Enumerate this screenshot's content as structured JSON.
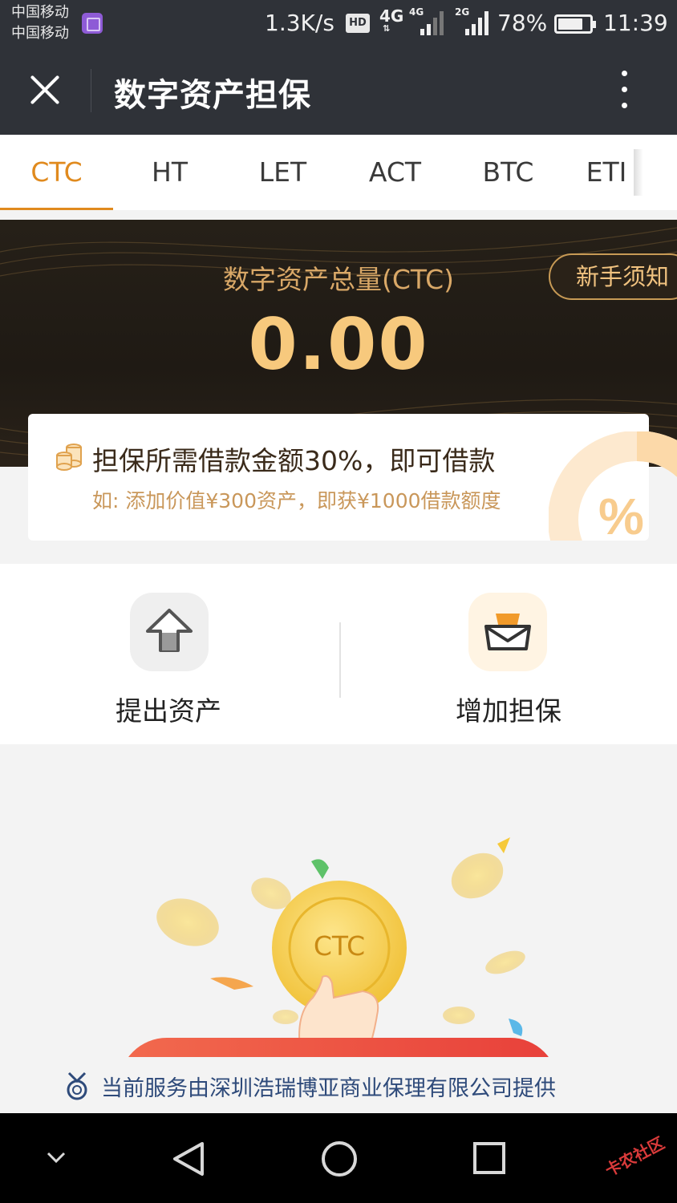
{
  "status_bar": {
    "carrier_1": "中国移动",
    "carrier_2": "中国移动",
    "net_speed": "1.3K/s",
    "hd_badge": "HD",
    "network_type": "4G",
    "sim1_tag": "4G",
    "sim2_tag": "2G",
    "battery": "78%",
    "time": "11:39"
  },
  "header": {
    "title": "数字资产担保",
    "close_icon": "close-icon",
    "more_icon": "more-vertical-icon"
  },
  "tabs": [
    {
      "label": "CTC",
      "active": true
    },
    {
      "label": "HT",
      "active": false
    },
    {
      "label": "LET",
      "active": false
    },
    {
      "label": "ACT",
      "active": false
    },
    {
      "label": "BTC",
      "active": false
    },
    {
      "label": "ETI",
      "active": false
    }
  ],
  "banner": {
    "total_label": "数字资产总量(CTC)",
    "total_value": "0.00",
    "guide_button": "新手须知"
  },
  "info_card": {
    "title": "担保所需借款金额30%，即可借款",
    "subtitle": "如: 添加价值¥300资产，即获¥1000借款额度",
    "icon": "coins-icon"
  },
  "actions": {
    "withdraw": {
      "label": "提出资产",
      "icon": "upload-arrow-icon"
    },
    "add": {
      "label": "增加担保",
      "icon": "wallet-icon"
    }
  },
  "illustration": {
    "coin_label": "CTC"
  },
  "provider_note": "当前服务由深圳浩瑞博亚商业保理有限公司提供",
  "watermark": "卡农社区",
  "colors": {
    "accent": "#e08a1e",
    "header_bg": "#2f3238",
    "banner_gold": "#f7c97d",
    "provider_text": "#2e4a7a"
  }
}
